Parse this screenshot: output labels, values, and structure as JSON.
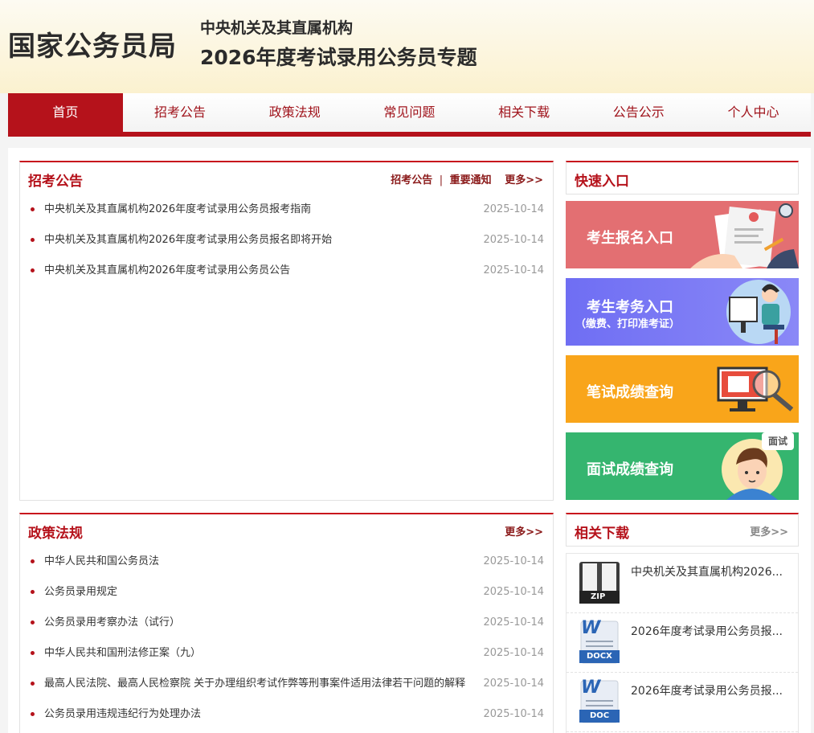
{
  "header": {
    "logo": "国家公务员局",
    "org": "中央机关及其直属机构",
    "topic": "2026年度考试录用公务员专题"
  },
  "nav": {
    "items": [
      "首页",
      "招考公告",
      "政策法规",
      "常见问题",
      "相关下载",
      "公告公示",
      "个人中心"
    ]
  },
  "recruit": {
    "title": "招考公告",
    "link1": "招考公告",
    "separator": "|",
    "link2": "重要通知",
    "more": "更多>>",
    "items": [
      {
        "text": "中央机关及其直属机构2026年度考试录用公务员报考指南",
        "date": "2025-10-14"
      },
      {
        "text": "中央机关及其直属机构2026年度考试录用公务员报名即将开始",
        "date": "2025-10-14"
      },
      {
        "text": "中央机关及其直属机构2026年度考试录用公务员公告",
        "date": "2025-10-14"
      }
    ]
  },
  "policy": {
    "title": "政策法规",
    "more": "更多>>",
    "items": [
      {
        "text": "中华人民共和国公务员法",
        "date": "2025-10-14"
      },
      {
        "text": "公务员录用规定",
        "date": "2025-10-14"
      },
      {
        "text": "公务员录用考察办法（试行）",
        "date": "2025-10-14"
      },
      {
        "text": "中华人民共和国刑法修正案（九）",
        "date": "2025-10-14"
      },
      {
        "text": "最高人民法院、最高人民检察院 关于办理组织考试作弊等刑事案件适用法律若干问题的解释",
        "date": "2025-10-14"
      },
      {
        "text": "公务员录用违规违纪行为处理办法",
        "date": "2025-10-14"
      }
    ]
  },
  "quick": {
    "title": "快速入口",
    "b1": "考生报名入口",
    "b2": "考生考务入口",
    "b2_sub": "（缴费、打印准考证）",
    "b3": "笔试成绩查询",
    "b4": "面试成绩查询",
    "b4_bubble": "面试"
  },
  "downloads": {
    "title": "相关下载",
    "more": "更多>>",
    "items": [
      {
        "name": "中央机关及其直属机构2026...",
        "type": "ZIP"
      },
      {
        "name": "2026年度考试录用公务员报...",
        "type": "DOCX"
      },
      {
        "name": "2026年度考试录用公务员报...",
        "type": "DOC"
      }
    ]
  },
  "colors": {
    "brand_red": "#b5121b",
    "quick1": "#e36f72",
    "quick2": "#7e7cf4",
    "quick3": "#f9a51a",
    "quick4": "#35b56f"
  }
}
